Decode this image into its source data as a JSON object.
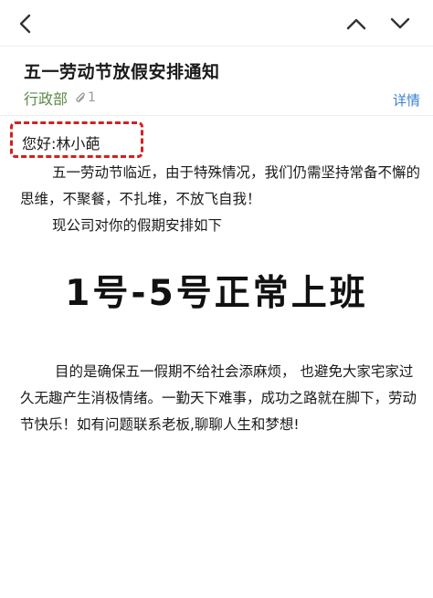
{
  "nav": {
    "back_icon": "chevron-left-icon",
    "prev_icon": "chevron-up-icon",
    "next_icon": "chevron-down-icon"
  },
  "email": {
    "subject": "五一劳动节放假安排通知",
    "sender": "行政部",
    "attachment_icon": "paperclip-icon",
    "attachment_count": "1",
    "details_label": "详情",
    "greeting": "您好:林小葩",
    "paragraph1": "五一劳动节临近，由于特殊情况，我们仍需坚持常备不懈的思维，不聚餐，不扎堆，不放飞自我！",
    "paragraph2": "现公司对你的假期安排如下",
    "headline": "1号-5号正常上班",
    "paragraph3": "目的是确保五一假期不给社会添麻烦， 也避免大家宅家过久无趣产生消极情绪。一勤天下难事，成功之路就在脚下，劳动节快乐！如有问题联系老板,聊聊人生和梦想!"
  },
  "colors": {
    "sender_green": "#5b8a47",
    "link_blue": "#3b7fd6",
    "highlight_red": "#d42020"
  }
}
